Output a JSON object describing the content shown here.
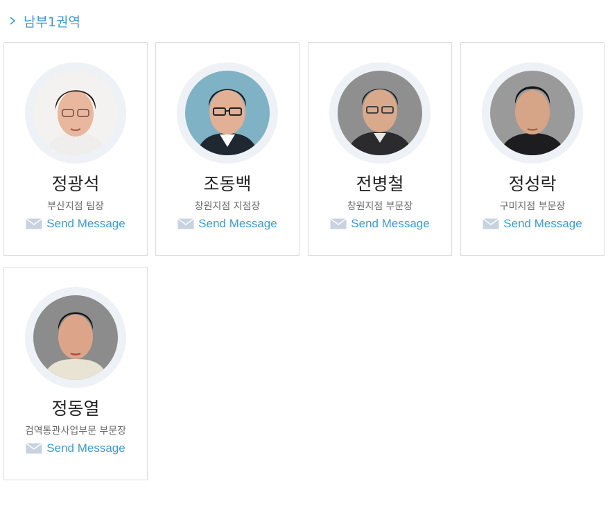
{
  "section": {
    "title": "남부1권역",
    "icon": "chevron-right-icon"
  },
  "staff": [
    {
      "name": "정광석",
      "title": "부산지점 팀장",
      "send_label": "Send Message"
    },
    {
      "name": "조동백",
      "title": "창원지점 지점장",
      "send_label": "Send Message"
    },
    {
      "name": "전병철",
      "title": "창원지점 부문장",
      "send_label": "Send Message"
    },
    {
      "name": "정성락",
      "title": "구미지점 부문장",
      "send_label": "Send Message"
    },
    {
      "name": "정동열",
      "title": "검역통관사업부문 부문장",
      "send_label": "Send Message"
    }
  ],
  "colors": {
    "accent": "#3d9ad1",
    "ring": "#eef1f5",
    "border": "#dcdcdc",
    "mail_icon": "#c7d3de"
  }
}
